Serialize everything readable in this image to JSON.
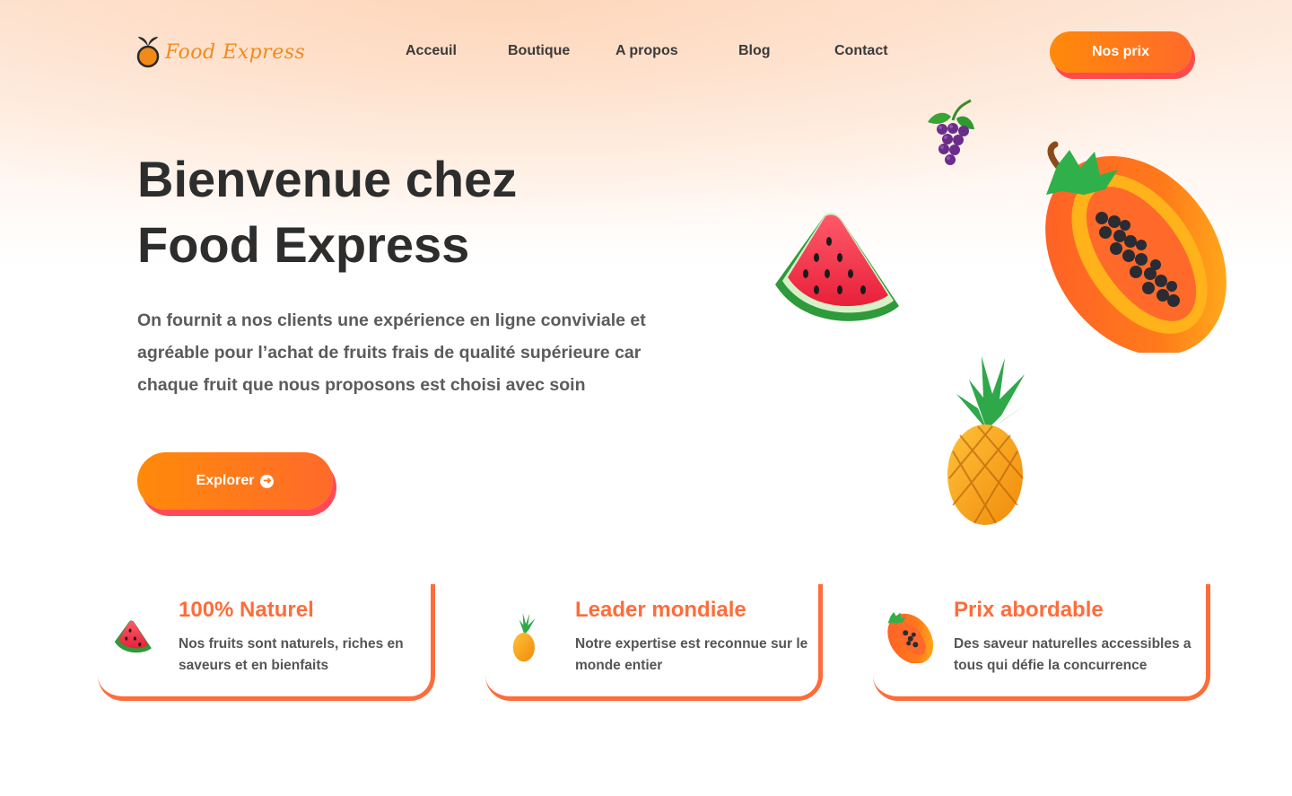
{
  "header": {
    "logo_text": "Food Express",
    "nav": [
      "Acceuil",
      "Boutique",
      "A propos",
      "Blog",
      "Contact"
    ],
    "cta_label": "Nos prix"
  },
  "hero": {
    "title_line1": "Bienvenue chez",
    "title_line2": "Food Express",
    "description": "On fournit a nos clients une expérience en ligne conviviale et agréable pour l’achat de fruits frais de qualité supérieure car chaque fruit que nous proposons est choisi avec soin",
    "button_label": "Explorer",
    "button_icon": "arrow-circle-right-icon"
  },
  "decorations": [
    "grapes-icon",
    "papaya-icon",
    "watermelon-icon",
    "pineapple-icon"
  ],
  "features": [
    {
      "icon": "watermelon-icon",
      "title": "100% Naturel",
      "description": "Nos fruits sont naturels, riches en saveurs et en bienfaits"
    },
    {
      "icon": "pineapple-icon",
      "title": "Leader mondiale",
      "description": "Notre expertise est reconnue sur le monde entier"
    },
    {
      "icon": "papaya-icon",
      "title": "Prix abordable",
      "description": "Des saveur naturelles accessibles a tous qui défie la concurrence"
    }
  ],
  "colors": {
    "accent": "#ff7a1a",
    "shadow": "#ff4a4a",
    "card_title": "#ff6c3a",
    "text_dark": "#2d2d2d",
    "text_gray": "#5b5b5b"
  }
}
